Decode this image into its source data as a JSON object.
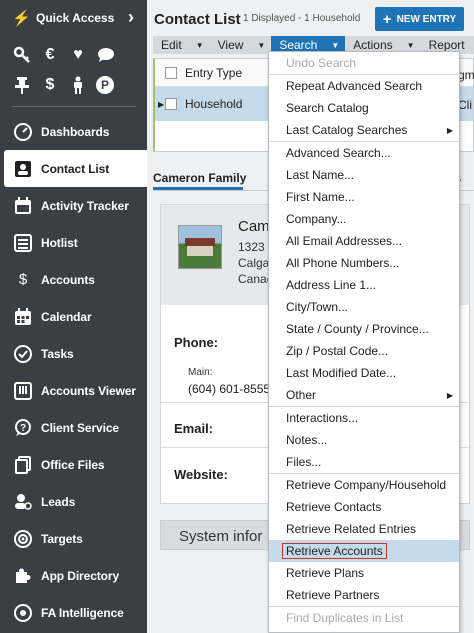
{
  "sidebar": {
    "quick_access_label": "Quick Access",
    "quick_icons_row1": [
      "key-icon",
      "euro-icon",
      "heart-icon",
      "chat-icon"
    ],
    "quick_icons_row2": [
      "pin-icon",
      "dollar-icon",
      "person-icon",
      "p-circle-icon"
    ],
    "items": [
      {
        "label": "Dashboards",
        "icon": "dashboard-icon"
      },
      {
        "label": "Contact List",
        "icon": "contact-card-icon",
        "active": true
      },
      {
        "label": "Activity Tracker",
        "icon": "calendar-activity-icon"
      },
      {
        "label": "Hotlist",
        "icon": "list-icon"
      },
      {
        "label": "Accounts",
        "icon": "dollar-icon"
      },
      {
        "label": "Calendar",
        "icon": "calendar-icon"
      },
      {
        "label": "Tasks",
        "icon": "check-circle-icon"
      },
      {
        "label": "Accounts Viewer",
        "icon": "columns-icon"
      },
      {
        "label": "Client Service",
        "icon": "question-chat-icon"
      },
      {
        "label": "Office Files",
        "icon": "files-icon"
      },
      {
        "label": "Leads",
        "icon": "user-search-icon"
      },
      {
        "label": "Targets",
        "icon": "target-icon"
      },
      {
        "label": "App Directory",
        "icon": "puzzle-icon"
      },
      {
        "label": "FA Intelligence",
        "icon": "gear-brain-icon"
      }
    ]
  },
  "header": {
    "title": "Contact List",
    "subtitle": "1 Displayed - 1 Household",
    "new_entry_label": "NEW ENTRY"
  },
  "menubar": {
    "items": [
      "Edit",
      "View",
      "Search",
      "Actions",
      "Report"
    ],
    "open_item": "Search"
  },
  "grid": {
    "columns": [
      "Entry Type"
    ],
    "rows": [
      [
        "Household"
      ]
    ],
    "clipped_col_header": "gm",
    "clipped_cell": "Cli"
  },
  "section": {
    "tab_label": "Cameron Family",
    "clipped_right": "s"
  },
  "card": {
    "name_partial": "Cam",
    "address_lines": [
      "1323",
      "Calga",
      "Canac"
    ],
    "phone_label": "Phone:",
    "phone_sub_label": "Main:",
    "phone_value": "(604) 601-8555",
    "email_label": "Email:",
    "website_label": "Website:"
  },
  "system_info_label": "System infor",
  "search_menu": {
    "groups": [
      [
        {
          "label": "Undo Search",
          "disabled": true
        }
      ],
      [
        {
          "label": "Repeat Advanced Search"
        },
        {
          "label": "Search Catalog"
        },
        {
          "label": "Last Catalog Searches",
          "submenu": true
        }
      ],
      [
        {
          "label": "Advanced Search..."
        },
        {
          "label": "Last Name..."
        },
        {
          "label": "First Name..."
        },
        {
          "label": "Company..."
        },
        {
          "label": "All Email Addresses..."
        },
        {
          "label": "All Phone Numbers..."
        },
        {
          "label": "Address Line 1..."
        },
        {
          "label": "City/Town..."
        },
        {
          "label": "State / County / Province..."
        },
        {
          "label": "Zip / Postal Code..."
        },
        {
          "label": "Last Modified Date..."
        },
        {
          "label": "Other",
          "submenu": true
        }
      ],
      [
        {
          "label": "Interactions..."
        },
        {
          "label": "Notes..."
        },
        {
          "label": "Files..."
        }
      ],
      [
        {
          "label": "Retrieve Company/Household"
        },
        {
          "label": "Retrieve Contacts"
        },
        {
          "label": "Retrieve Related Entries"
        },
        {
          "label": "Retrieve Accounts",
          "highlighted": true
        },
        {
          "label": "Retrieve Plans"
        },
        {
          "label": "Retrieve Partners"
        }
      ],
      [
        {
          "label": "Find Duplicates in List",
          "disabled": true
        }
      ]
    ]
  },
  "colors": {
    "sidebar_bg": "#3b3f44",
    "accent_blue": "#1f73b7",
    "highlight_row": "#c5dbeb",
    "highlight_border": "#c0392b"
  }
}
